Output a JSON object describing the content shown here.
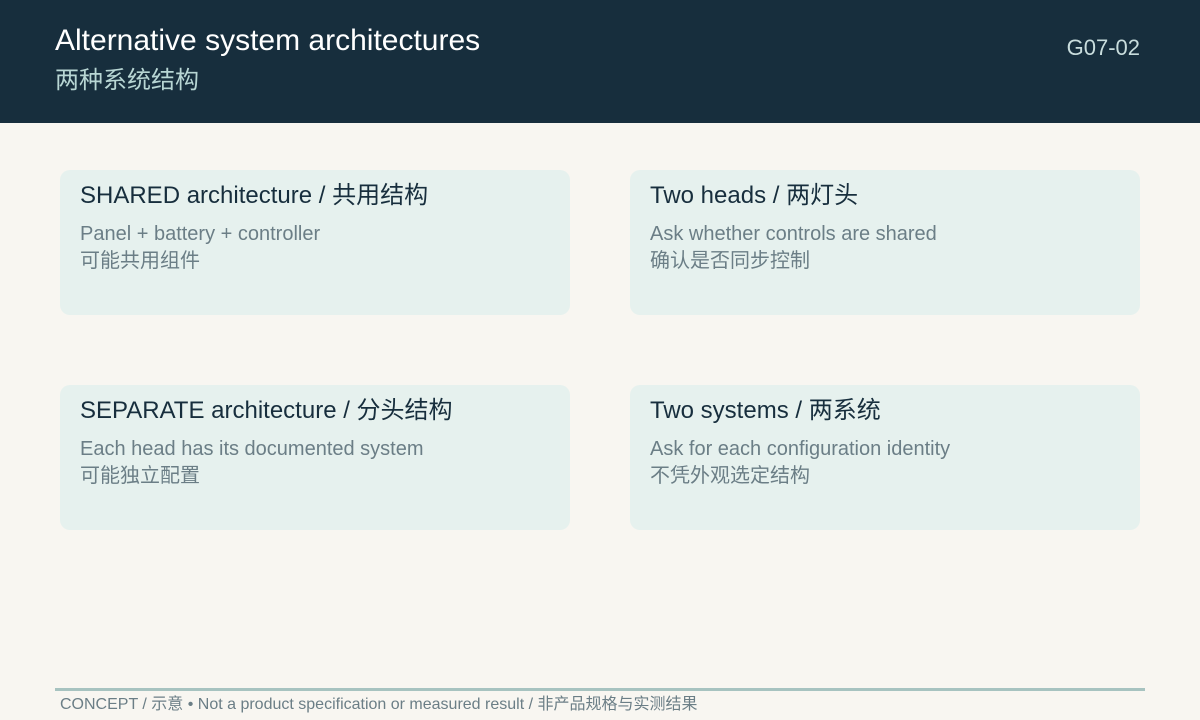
{
  "header": {
    "title_en": "Alternative system architectures",
    "title_zh": "两种系统结构",
    "code": "G07-02"
  },
  "cards": [
    {
      "title": "SHARED architecture / 共用结构",
      "line1": "Panel + battery + controller",
      "line2": "可能共用组件"
    },
    {
      "title": "Two heads / 两灯头",
      "line1": "Ask whether controls are shared",
      "line2": "确认是否同步控制"
    },
    {
      "title": "SEPARATE architecture / 分头结构",
      "line1": "Each head has its documented system",
      "line2": "可能独立配置"
    },
    {
      "title": "Two systems / 两系统",
      "line1": "Ask for each configuration identity",
      "line2": "不凭外观选定结构"
    }
  ],
  "footer": {
    "text": "CONCEPT / 示意 • Not a product specification or measured result / 非产品规格与实测结果"
  },
  "colors": {
    "header_bg": "#172e3d",
    "page_bg": "#f8f6f1",
    "card_bg": "#e6f1ee",
    "accent": "#a7c3c0"
  }
}
